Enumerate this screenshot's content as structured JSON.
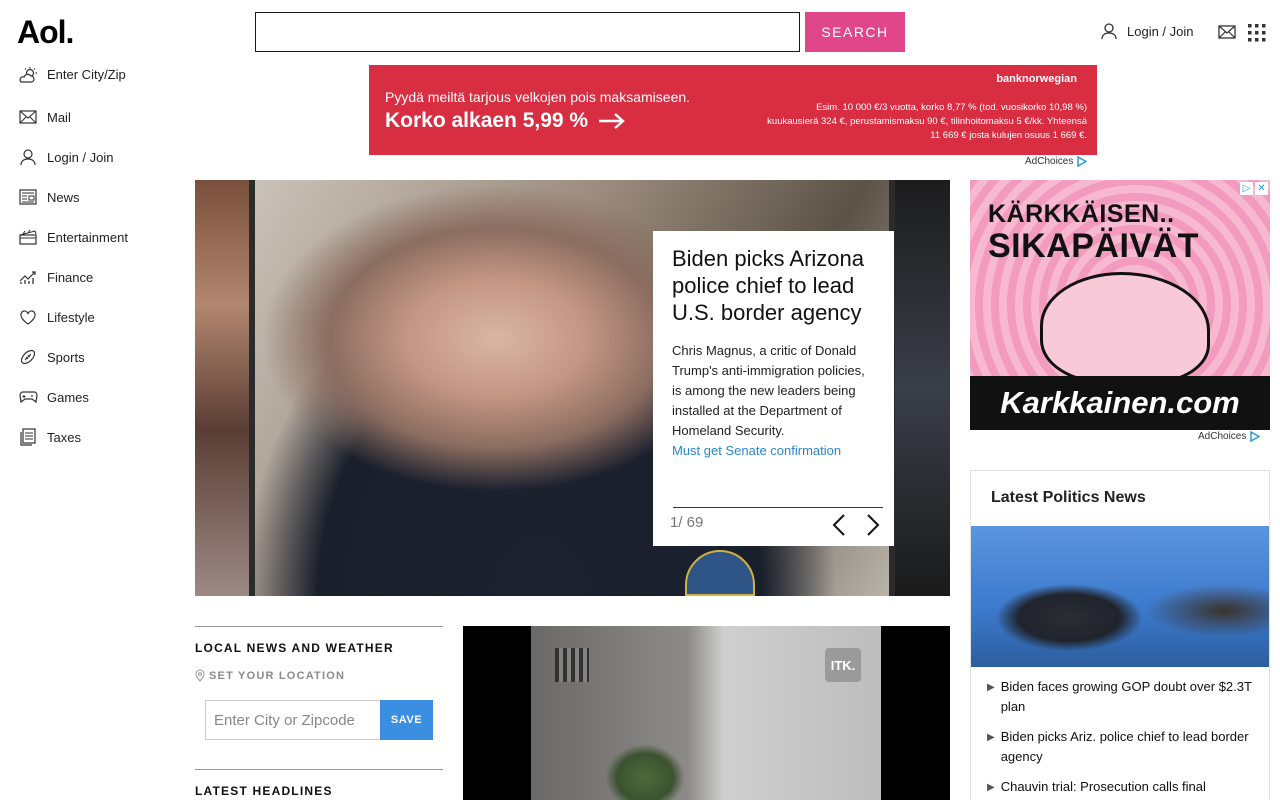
{
  "header": {
    "logo": "Aol.",
    "search": {
      "value": "",
      "placeholder": "",
      "button": "SEARCH"
    },
    "login": "Login / Join"
  },
  "sidebar": {
    "items": [
      {
        "label": "Enter City/Zip",
        "icon": "weather-icon"
      },
      {
        "label": "Mail",
        "icon": "mail-icon"
      },
      {
        "label": "Login / Join",
        "icon": "user-icon"
      },
      {
        "label": "News",
        "icon": "news-icon"
      },
      {
        "label": "Entertainment",
        "icon": "clapperboard-icon"
      },
      {
        "label": "Finance",
        "icon": "chart-icon"
      },
      {
        "label": "Lifestyle",
        "icon": "heart-icon"
      },
      {
        "label": "Sports",
        "icon": "football-icon"
      },
      {
        "label": "Games",
        "icon": "gamepad-icon"
      },
      {
        "label": "Taxes",
        "icon": "documents-icon"
      }
    ]
  },
  "top_ad": {
    "brand": "banknorwegian",
    "line1": "Pyydä meiltä tarjous velkojen pois maksamiseen.",
    "line2": "Korko alkaen 5,99 %",
    "fine": "Esim. 10 000 €/3 vuotta, korko 8,77 % (tod. vuosikorko 10,98 %) kuukausierä 324 €, perustamismaksu 90 €, tilinhoitomaksu 5 €/kk. Yhteensä 11 669 € josta kulujen osuus 1 669 €.",
    "adchoices": "AdChoices",
    "color": "#d92e42"
  },
  "hero": {
    "title": "Biden picks Arizona police chief to lead U.S. border agency",
    "description": "Chris Magnus, a critic of Donald Trump's anti-immigration policies, is among the new leaders being installed at the Department of Homeland Security.",
    "link": "Must get Senate confirmation",
    "counter": "1/ 69"
  },
  "local_news": {
    "title": "LOCAL NEWS AND WEATHER",
    "set_location": "SET YOUR LOCATION",
    "zip_placeholder": "Enter City or Zipcode",
    "save": "SAVE",
    "latest": "LATEST HEADLINES"
  },
  "video": {
    "watermark": "ITK."
  },
  "side_ad": {
    "line1": "KÄRKKÄISEN..",
    "line2": "SIKAPÄIVÄT",
    "site": "Karkkainen.com",
    "adchoices": "AdChoices"
  },
  "politics": {
    "title": "Latest Politics News",
    "items": [
      "Biden faces growing GOP doubt over $2.3T plan",
      "Biden picks Ariz. police chief to lead border agency",
      "Chauvin trial: Prosecution calls final"
    ]
  },
  "colors": {
    "accent": "#e0478a",
    "link": "#2a88c9",
    "save": "#3a8fe0"
  }
}
